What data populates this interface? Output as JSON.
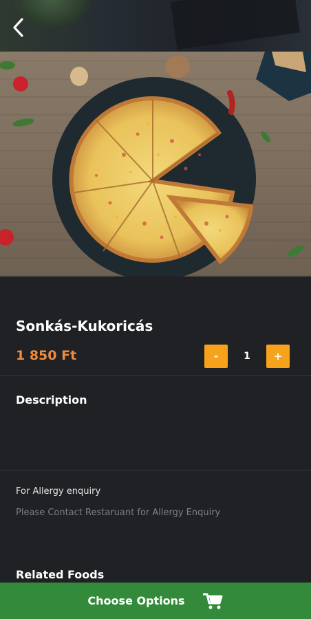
{
  "header": {
    "back_icon": "chevron-left-icon"
  },
  "hero": {
    "image": "pizza-photo"
  },
  "product": {
    "name": "Sonkás-Kukoricás",
    "price": "1 850 Ft",
    "quantity": "1",
    "decrement_label": "-",
    "increment_label": "+"
  },
  "description": {
    "title": "Description"
  },
  "allergy": {
    "label": "For Allergy enquiry",
    "text": "Please Contact Restaruant for Allergy Enquiry"
  },
  "related": {
    "title": "Related Foods"
  },
  "cta": {
    "label": "Choose Options",
    "icon": "shopping-cart-icon"
  },
  "colors": {
    "accent": "#f28a3a",
    "qty_button": "#f7a21b",
    "cta": "#338a3a",
    "background": "#202125"
  }
}
